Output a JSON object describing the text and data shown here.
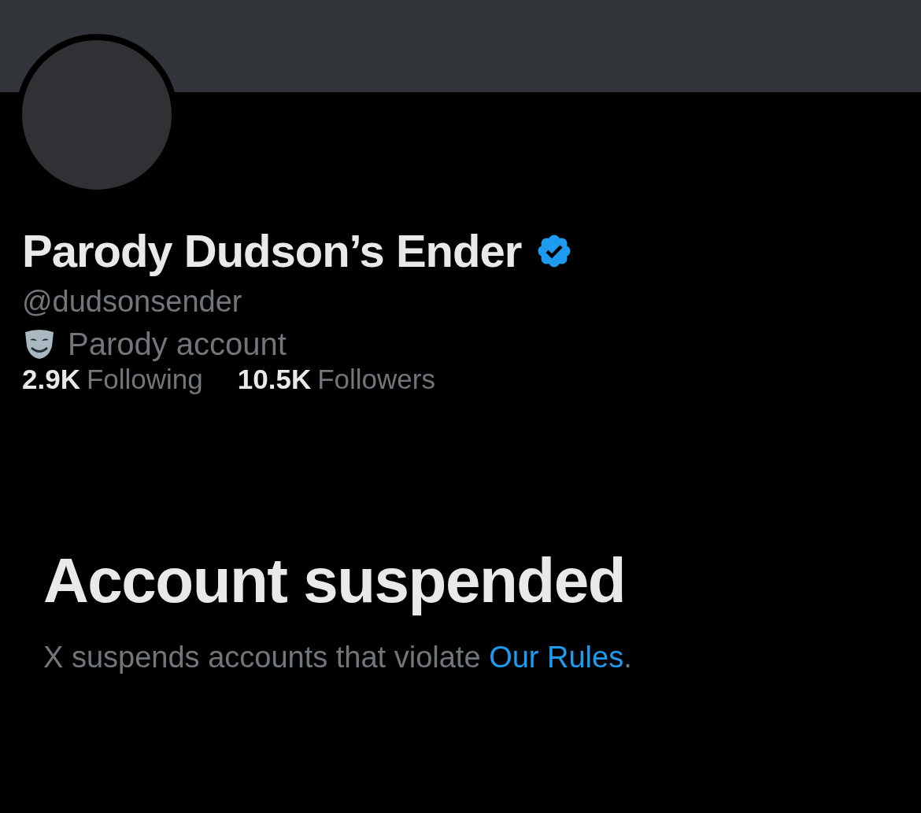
{
  "profile": {
    "name": "Parody Dudson’s Ender",
    "verified": true,
    "handle": "@dudsonsender",
    "label": "Parody account",
    "stats": [
      {
        "count": "2.9K",
        "label": "Following"
      },
      {
        "count": "10.5K",
        "label": "Followers"
      }
    ]
  },
  "notice": {
    "title": "Account suspended",
    "text_before": "X suspends accounts that violate ",
    "link": "Our Rules",
    "text_after": "."
  }
}
